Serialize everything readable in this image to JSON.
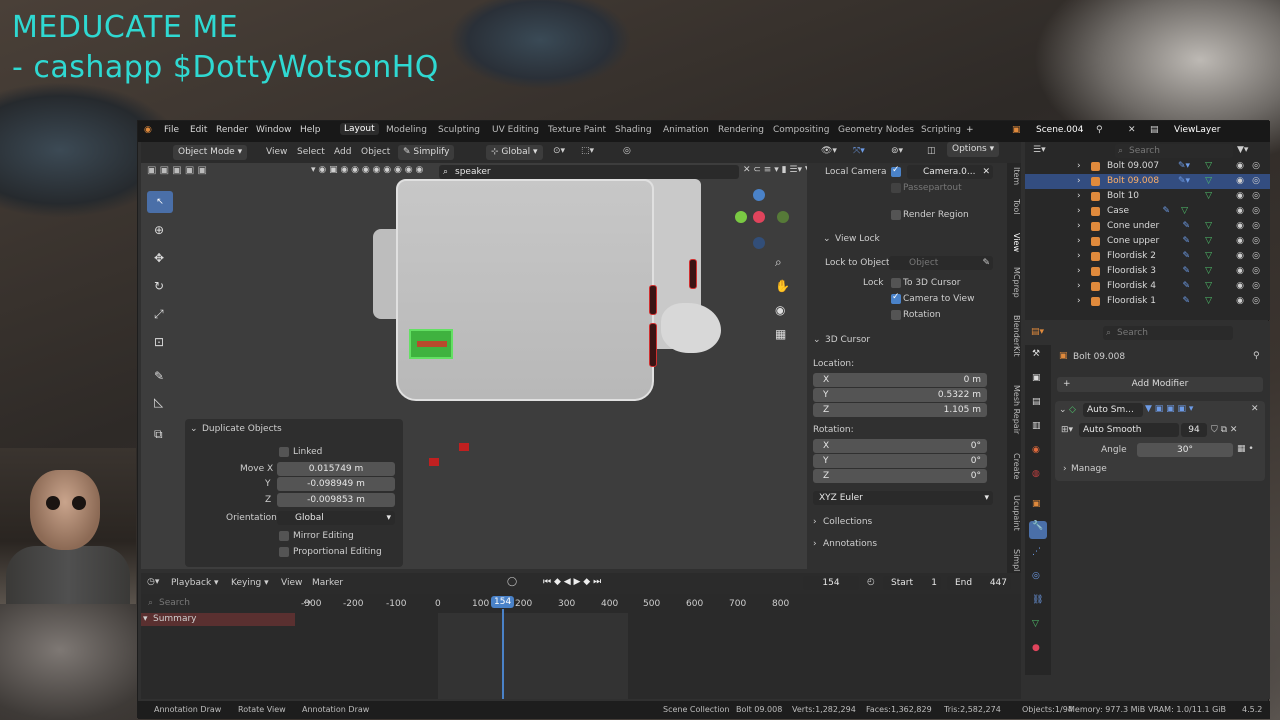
{
  "overlay": {
    "line1": "MEDUCATE ME",
    "line2": "- cashapp $DottyWotsonHQ"
  },
  "menu": {
    "file": "File",
    "edit": "Edit",
    "render": "Render",
    "window": "Window",
    "help": "Help"
  },
  "workspaces": [
    "Layout",
    "Modeling",
    "Sculpting",
    "UV Editing",
    "Texture Paint",
    "Shading",
    "Animation",
    "Rendering",
    "Compositing",
    "Geometry Nodes",
    "Scripting"
  ],
  "scene": "Scene.004",
  "view_layer": "ViewLayer",
  "viewport_header": {
    "mode": "Object Mode",
    "view": "View",
    "select": "Select",
    "add": "Add",
    "object": "Object",
    "simplify": "Simplify",
    "orientation": "Global",
    "search_value": "speaker"
  },
  "operator_panel": {
    "title": "Duplicate Objects",
    "linked": "Linked",
    "move_x_label": "Move X",
    "y_label": "Y",
    "z_label": "Z",
    "move_x": "0.015749 m",
    "move_y": "-0.098949 m",
    "move_z": "-0.009853 m",
    "orientation_label": "Orientation",
    "orientation": "Global",
    "mirror": "Mirror Editing",
    "proportional": "Proportional Editing"
  },
  "n_panel": {
    "local_camera_label": "Local Camera",
    "camera": "Camera.0...",
    "passepartout": "Passepartout",
    "render_region": "Render Region",
    "view_lock": "View Lock",
    "lock_to_object": "Lock to Object",
    "object_placeholder": "Object",
    "lock": "Lock",
    "to_3d_cursor": "To 3D Cursor",
    "camera_to_view": "Camera to View",
    "rotation": "Rotation",
    "cursor_title": "3D Cursor",
    "location": "Location:",
    "rotation_label": "Rotation:",
    "x": "X",
    "y": "Y",
    "z": "Z",
    "loc_x": "0 m",
    "loc_y": "0.5322 m",
    "loc_z": "1.105 m",
    "rot_x": "0°",
    "rot_y": "0°",
    "rot_z": "0°",
    "euler": "XYZ Euler",
    "collections": "Collections",
    "annotations": "Annotations",
    "options": "Options"
  },
  "side_tabs": [
    "Item",
    "Tool",
    "View",
    "MCprep",
    "BlenderKit",
    "Mesh Repair",
    "Create",
    "Ucupaint",
    "Simpl"
  ],
  "outliner": {
    "search_placeholder": "Search",
    "rows": [
      "Bolt 09.007",
      "Bolt 09.008",
      "Bolt 10",
      "Case",
      "Cone under",
      "Cone upper",
      "Floordisk 2",
      "Floordisk 3",
      "Floordisk 4",
      "Floordisk 1"
    ]
  },
  "properties": {
    "search_placeholder": "Search",
    "object": "Bolt 09.008",
    "add_modifier": "Add Modifier",
    "mod_short": "Auto Sm...",
    "node_group": "Auto Smooth",
    "users": "94",
    "angle_label": "Angle",
    "angle": "30°",
    "manage": "Manage"
  },
  "timeline": {
    "playback": "Playback",
    "keying": "Keying",
    "view": "View",
    "marker": "Marker",
    "current": "154",
    "start_label": "Start",
    "start": "1",
    "end_label": "End",
    "end": "447",
    "search_placeholder": "Search",
    "summary": "Summary",
    "ticks": [
      "-300",
      "-200",
      "-100",
      "0",
      "100",
      "200",
      "300",
      "400",
      "500",
      "600",
      "700",
      "800"
    ]
  },
  "status": {
    "a1": "Annotation Draw",
    "a2": "Rotate View",
    "a3": "Annotation Draw",
    "scene_col": "Scene Collection",
    "obj": "Bolt 09.008",
    "verts": "Verts:1,282,294",
    "faces": "Faces:1,362,829",
    "tris": "Tris:2,582,274",
    "objects": "Objects:1/94",
    "memory": "Memory: 977.3 MiB",
    "vram": "VRAM: 1.0/11.1 GiB",
    "version": "4.5.2"
  }
}
